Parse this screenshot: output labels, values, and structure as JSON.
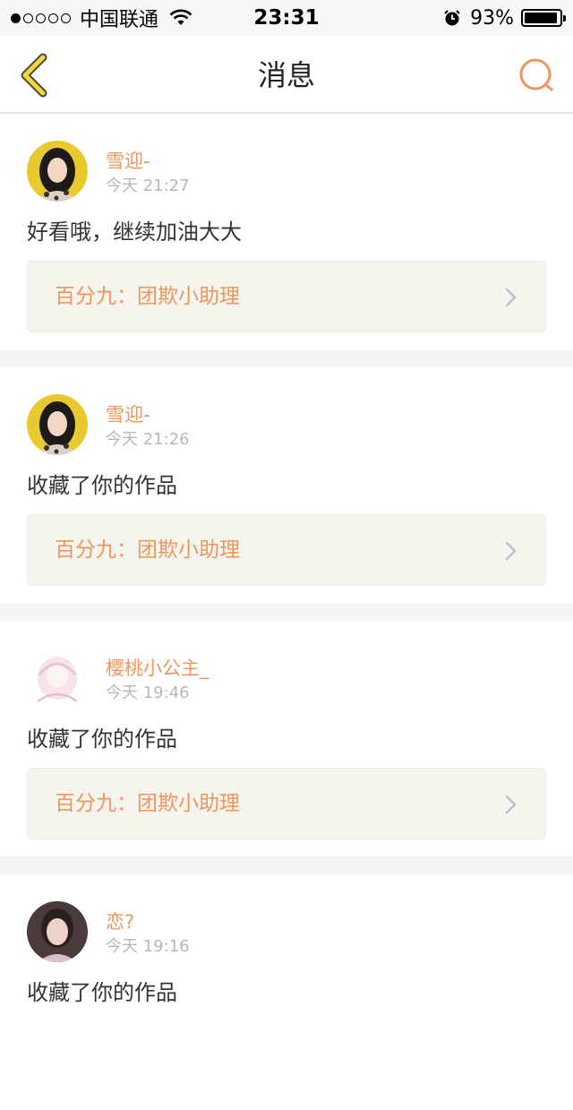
{
  "status_bar": {
    "carrier": "中国联通",
    "time": "23:31",
    "battery": "93%"
  },
  "nav": {
    "title": "消息",
    "back_icon": "back-arrow-icon",
    "search_icon": "search-icon"
  },
  "colors": {
    "accent": "#f0955e",
    "back_arrow": "#f5d838",
    "ref_bg": "#f5f5ee"
  },
  "messages": [
    {
      "username": "雪迎-",
      "time": "今天 21:27",
      "text": "好看哦，继续加油大大",
      "ref": "百分九：团欺小助理"
    },
    {
      "username": "雪迎-",
      "time": "今天 21:26",
      "text": "收藏了你的作品",
      "ref": "百分九：团欺小助理"
    },
    {
      "username": "樱桃小公主_",
      "time": "今天 19:46",
      "text": "收藏了你的作品",
      "ref": "百分九：团欺小助理"
    },
    {
      "username": "恋?",
      "time": "今天 19:16",
      "text": "收藏了你的作品"
    }
  ]
}
